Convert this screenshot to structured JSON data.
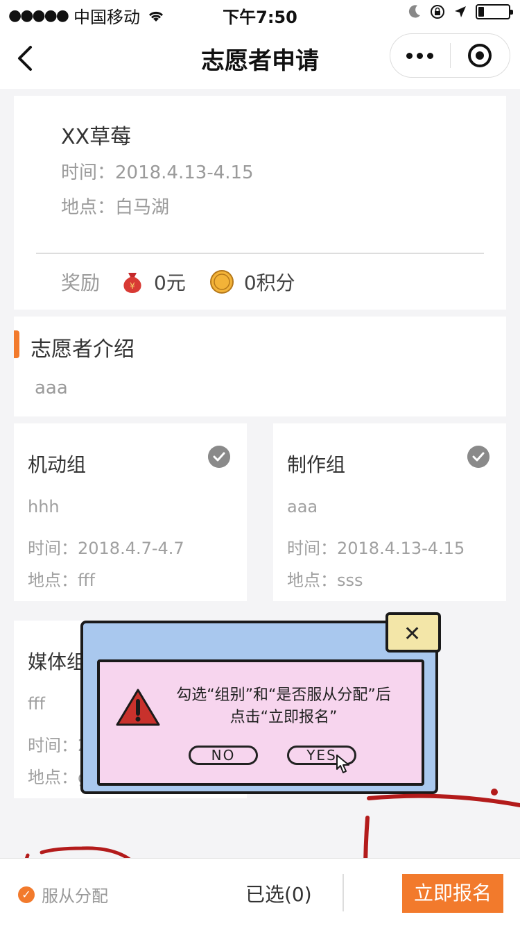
{
  "status_bar": {
    "signal": "●●●●●",
    "carrier": "中国移动",
    "time": "下午7:50",
    "battery_level": 0.2
  },
  "nav": {
    "title": "志愿者申请"
  },
  "event": {
    "name": "XX草莓",
    "time": "时间：2018.4.13-4.15",
    "place": "地点：白马湖",
    "reward_label": "奖励",
    "reward_money": "0元",
    "reward_points": "0积分"
  },
  "intro": {
    "title": "志愿者介绍",
    "text": "aaa"
  },
  "groups": [
    {
      "name": "机动组",
      "desc": "hhh",
      "time": "时间：2018.4.7-4.7",
      "place": "地点：fff"
    },
    {
      "name": "制作组",
      "desc": "aaa",
      "time": "时间：2018.4.13-4.15",
      "place": "地点：sss"
    },
    {
      "name": "媒体组",
      "desc": "fff",
      "time": "时间：2",
      "place": "地点：g"
    }
  ],
  "popup": {
    "line1": "勾选“组别”和“是否服从分配”后",
    "line2": "点击“立即报名”",
    "no_label": "NO",
    "yes_label": "YES",
    "close_label": "✕"
  },
  "bottom": {
    "obey_label": "服从分配",
    "selected_text": "已选(0)",
    "apply_label": "立即报名"
  },
  "colors": {
    "accent": "#f27a2c",
    "annotation": "#b31b1b"
  }
}
